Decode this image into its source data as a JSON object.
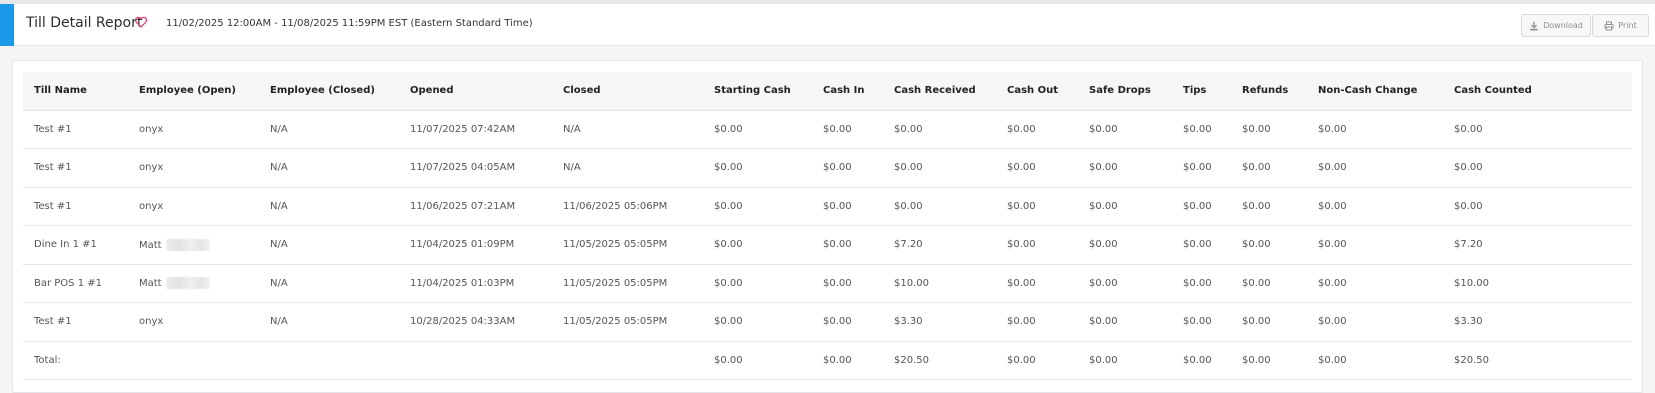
{
  "colors": {
    "accent": "#1a9ae6",
    "heart": "#e2407a"
  },
  "header": {
    "title": "Till Detail Report",
    "heart_icon": "heart-outline-icon",
    "date_range": "11/02/2025 12:00AM - 11/08/2025 11:59PM EST (Eastern Standard Time)",
    "download_label": "Download",
    "download_icon": "download-icon",
    "print_label": "Print",
    "print_icon": "printer-icon"
  },
  "table": {
    "columns": [
      "Till Name",
      "Employee (Open)",
      "Employee (Closed)",
      "Opened",
      "Closed",
      "Starting Cash",
      "Cash In",
      "Cash Received",
      "Cash Out",
      "Safe Drops",
      "Tips",
      "Refunds",
      "Non-Cash Change",
      "Cash Counted"
    ],
    "rows": [
      [
        "Test #1",
        "onyx",
        "N/A",
        "11/07/2025 07:42AM",
        "N/A",
        "$0.00",
        "$0.00",
        "$0.00",
        "$0.00",
        "$0.00",
        "$0.00",
        "$0.00",
        "$0.00",
        "$0.00"
      ],
      [
        "Test #1",
        "onyx",
        "N/A",
        "11/07/2025 04:05AM",
        "N/A",
        "$0.00",
        "$0.00",
        "$0.00",
        "$0.00",
        "$0.00",
        "$0.00",
        "$0.00",
        "$0.00",
        "$0.00"
      ],
      [
        "Test #1",
        "onyx",
        "N/A",
        "11/06/2025 07:21AM",
        "11/06/2025 05:06PM",
        "$0.00",
        "$0.00",
        "$0.00",
        "$0.00",
        "$0.00",
        "$0.00",
        "$0.00",
        "$0.00",
        "$0.00"
      ],
      [
        "Dine In 1 #1",
        "Matt",
        "N/A",
        "11/04/2025 01:09PM",
        "11/05/2025 05:05PM",
        "$0.00",
        "$0.00",
        "$7.20",
        "$0.00",
        "$0.00",
        "$0.00",
        "$0.00",
        "$0.00",
        "$7.20"
      ],
      [
        "Bar POS 1 #1",
        "Matt",
        "N/A",
        "11/04/2025 01:03PM",
        "11/05/2025 05:05PM",
        "$0.00",
        "$0.00",
        "$10.00",
        "$0.00",
        "$0.00",
        "$0.00",
        "$0.00",
        "$0.00",
        "$10.00"
      ],
      [
        "Test #1",
        "onyx",
        "N/A",
        "10/28/2025 04:33AM",
        "11/05/2025 05:05PM",
        "$0.00",
        "$0.00",
        "$3.30",
        "$0.00",
        "$0.00",
        "$0.00",
        "$0.00",
        "$0.00",
        "$3.30"
      ]
    ],
    "total": [
      "Total:",
      "",
      "",
      "",
      "",
      "$0.00",
      "$0.00",
      "$20.50",
      "$0.00",
      "$0.00",
      "$0.00",
      "$0.00",
      "$0.00",
      "$20.50"
    ]
  }
}
